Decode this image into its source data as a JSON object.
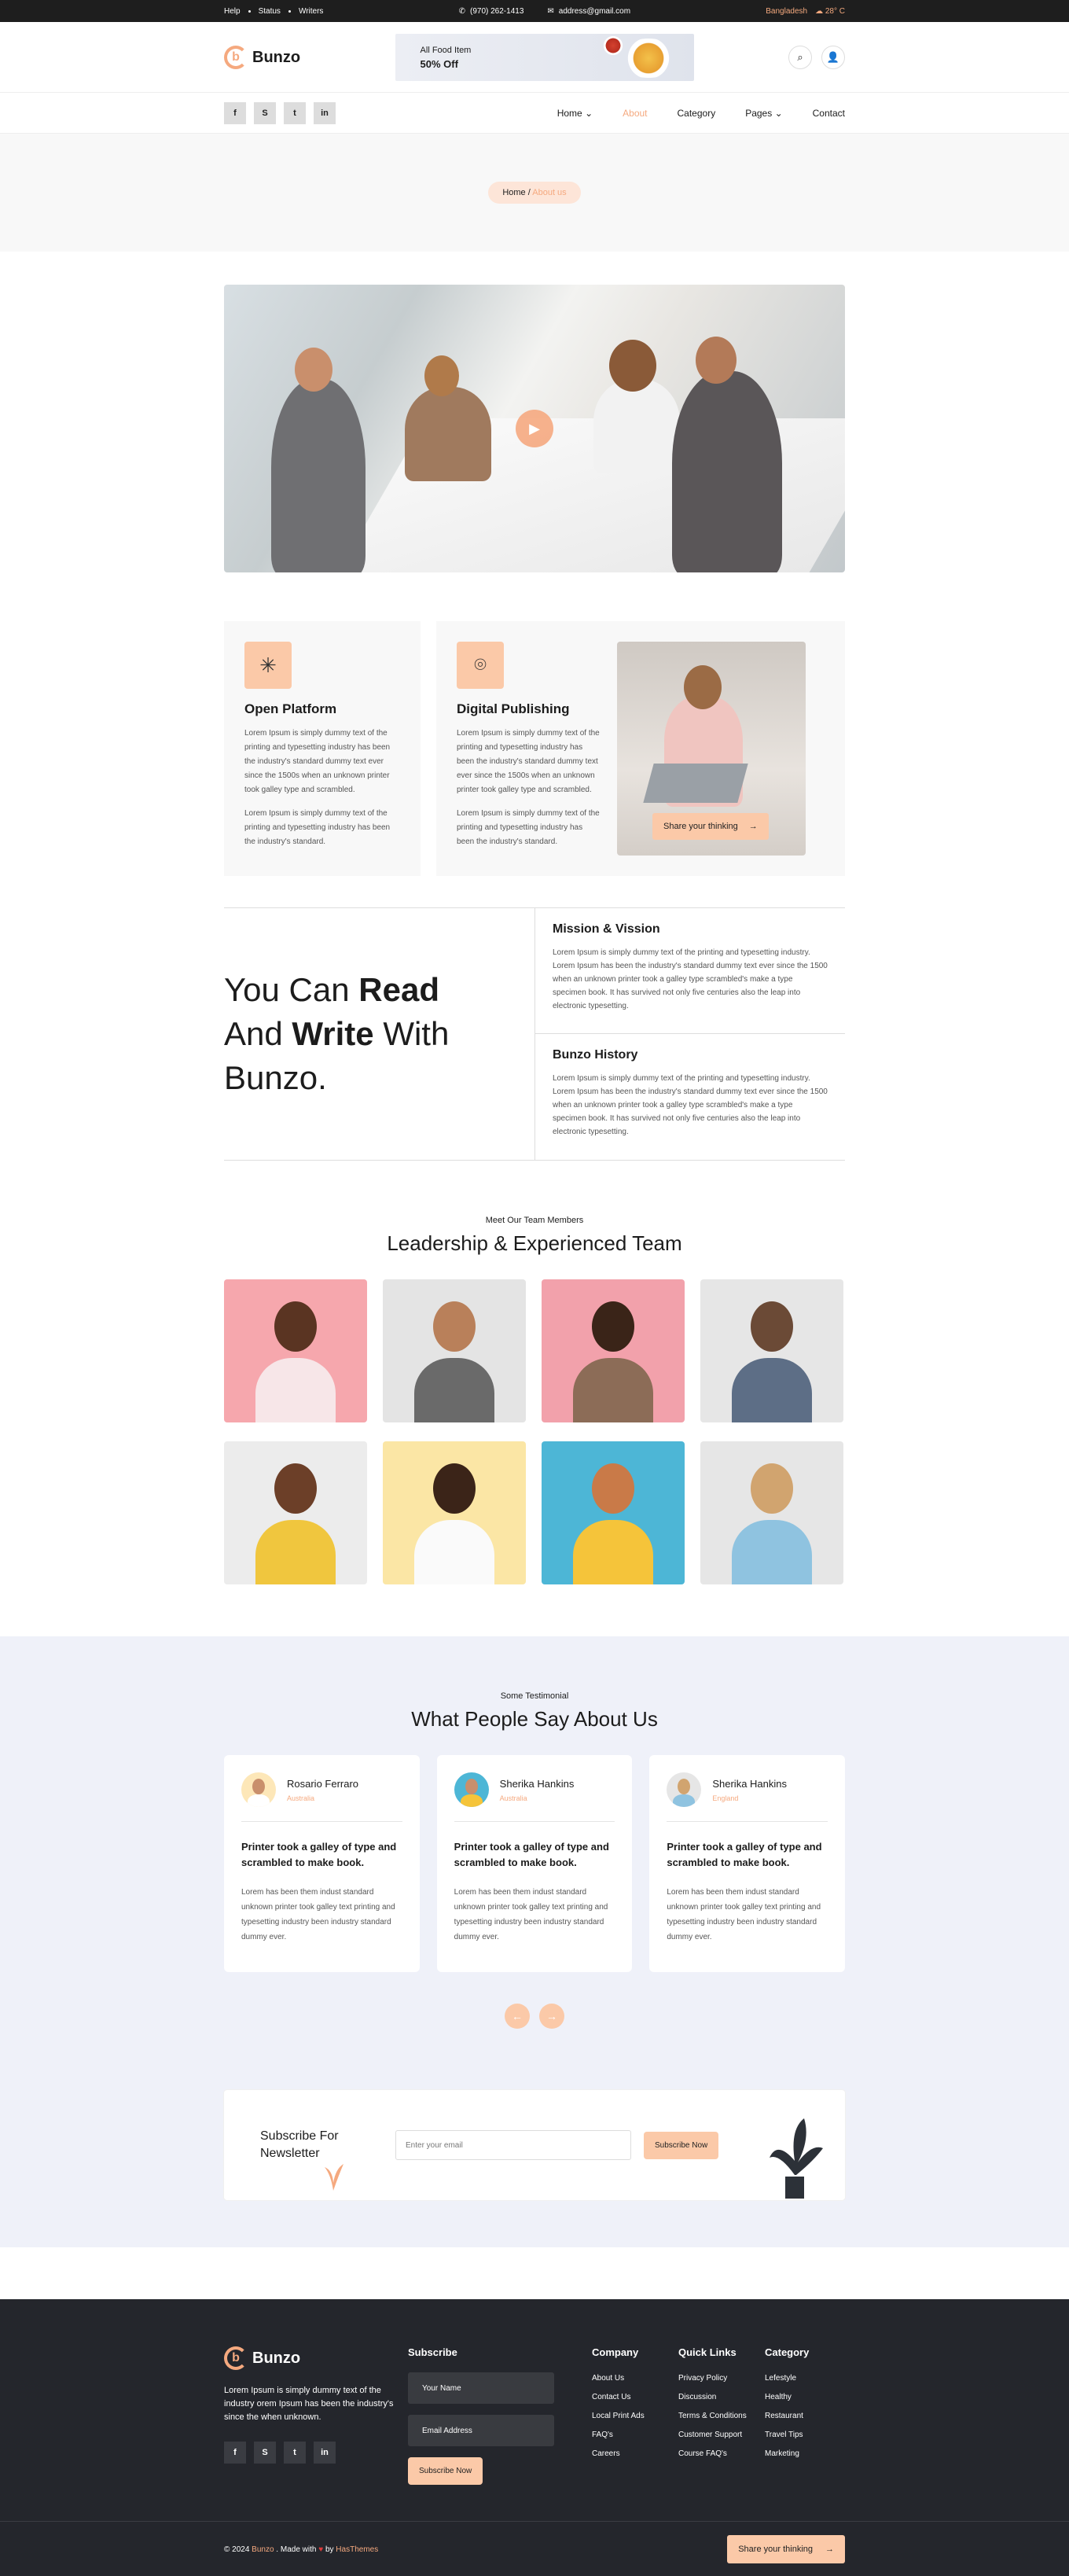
{
  "topbar": {
    "links": [
      "Help",
      "Status",
      "Writers"
    ],
    "phone": "(970) 262-1413",
    "email": "address@gmail.com",
    "location": "Bangladesh",
    "temperature": "28° C"
  },
  "header": {
    "brand": "Bunzo",
    "promo_line1": "All Food Item",
    "promo_line2": "50% Off"
  },
  "nav": {
    "socials": [
      "f",
      "S",
      "t",
      "in"
    ],
    "menu": [
      "Home",
      "About",
      "Category",
      "Pages",
      "Contact"
    ],
    "active": "About"
  },
  "breadcrumb": {
    "home": "Home",
    "sep": "/",
    "current": "About us"
  },
  "features": {
    "card1": {
      "title": "Open Platform",
      "p1": "Lorem Ipsum is simply dummy text of the printing and typesetting industry has been the industry's standard dummy text ever since the 1500s when an unknown printer took galley type and scrambled.",
      "p2": "Lorem Ipsum is simply dummy text of the printing and typesetting industry has been the industry's standard."
    },
    "card2": {
      "title": "Digital Publishing",
      "p1": "Lorem Ipsum is simply dummy text of the printing and typesetting industry has been the industry's standard dummy text ever since the 1500s when an unknown printer took galley type and scrambled.",
      "p2": "Lorem Ipsum is simply dummy text of the printing and typesetting industry has been the industry's standard."
    },
    "share_label": "Share your thinking"
  },
  "readwrite": {
    "line1a": "You Can ",
    "line1b": "Read",
    "line2a": "And ",
    "line2b": "Write",
    "line2c": " With",
    "line3": "Bunzo.",
    "mission_title": "Mission & Vission",
    "mission_text": "Lorem Ipsum is simply dummy text of the printing and typesetting industry. Lorem Ipsum has been the industry's standard dummy text ever since the 1500 when an unknown printer took a galley type scrambled's make a type specimen book. It has survived not only five centuries also the leap into electronic typesetting.",
    "history_title": "Bunzo History",
    "history_text": "Lorem Ipsum is simply dummy text of the printing and typesetting industry. Lorem Ipsum has been the industry's standard dummy text ever since the 1500 when an unknown printer took a galley type scrambled's make a type specimen book. It has survived not only five centuries also the leap into electronic typesetting."
  },
  "team": {
    "subtitle": "Meet Our Team Members",
    "title": "Leadership & Experienced Team"
  },
  "testimonial": {
    "subtitle": "Some Testimonial",
    "title": "What People Say About Us",
    "cards": [
      {
        "name": "Rosario Ferraro",
        "role": "Australia",
        "quote": "Printer took a galley of type and scrambled to make book.",
        "text": "Lorem has been them indust standard unknown printer took galley text printing and typesetting industry been industry standard dummy ever."
      },
      {
        "name": "Sherika Hankins",
        "role": "Australia",
        "quote": "Printer took a galley of type and scrambled to make book.",
        "text": "Lorem has been them indust standard unknown printer took galley text printing and typesetting industry been industry standard dummy ever."
      },
      {
        "name": "Sherika Hankins",
        "role": "England",
        "quote": "Printer took a galley of type and scrambled to make book.",
        "text": "Lorem has been them indust standard unknown printer took galley text printing and typesetting industry been industry standard dummy ever."
      }
    ],
    "prev": "←",
    "next": "→"
  },
  "newsletter": {
    "title": "Subscribe For Newsletter",
    "placeholder": "Enter your email",
    "button": "Subscribe Now"
  },
  "footer": {
    "brand": "Bunzo",
    "about": "Lorem Ipsum is simply dummy text of the industry orem Ipsum has been the industry's since the when unknown.",
    "subscribe_title": "Subscribe",
    "name_placeholder": "Your Name",
    "email_placeholder": "Email Address",
    "subscribe_button": "Subscribe Now",
    "company_title": "Company",
    "company": [
      "About Us",
      "Contact Us",
      "Local Print Ads",
      "FAQ's",
      "Careers"
    ],
    "quick_title": "Quick Links",
    "quick": [
      "Privacy Policy",
      "Discussion",
      "Terms & Conditions",
      "Customer Support",
      "Course FAQ's"
    ],
    "category_title": "Category",
    "category": [
      "Lefestyle",
      "Healthy",
      "Restaurant",
      "Travel Tips",
      "Marketing"
    ],
    "copy_a": "© 2024 ",
    "copy_brand": "Bunzo",
    "copy_b": " . Made with ",
    "copy_heart": "♥",
    "copy_c": " by ",
    "copy_author": "HasThemes",
    "share_label": "Share your thinking"
  },
  "colors": {
    "accent": "#f5a97f",
    "accent_light": "#fbc9a8",
    "dark": "#24262c"
  }
}
